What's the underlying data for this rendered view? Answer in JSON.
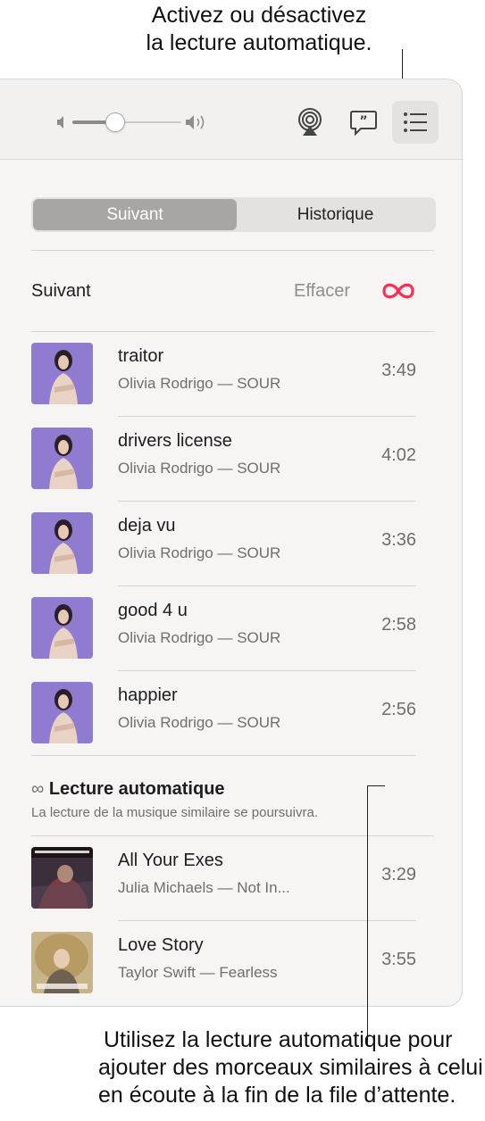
{
  "callouts": {
    "top_line1": "Activez ou désactivez",
    "top_line2": "la lecture automatique.",
    "bottom_line1": "Utilisez la lecture automatique pour",
    "bottom_line2": "ajouter des morceaux similaires à celui",
    "bottom_line3": "en écoute à la fin de la file d’attente."
  },
  "toolbar": {
    "volume_level": 0.38,
    "icons": [
      "volume-low-icon",
      "volume-high-icon",
      "airplay-icon",
      "lyrics-icon",
      "queue-list-icon"
    ]
  },
  "tabs": {
    "next": "Suivant",
    "history": "Historique",
    "selected": "Suivant"
  },
  "queue": {
    "section_title": "Suivant",
    "clear_label": "Effacer",
    "autoplay_icon": "infinity-icon",
    "accent_color": "#ff2d55",
    "tracks": [
      {
        "title": "traitor",
        "subtitle": "Olivia Rodrigo — SOUR",
        "duration": "3:49"
      },
      {
        "title": "drivers license",
        "subtitle": "Olivia Rodrigo — SOUR",
        "duration": "4:02"
      },
      {
        "title": "deja vu",
        "subtitle": "Olivia Rodrigo — SOUR",
        "duration": "3:36"
      },
      {
        "title": "good 4 u",
        "subtitle": "Olivia Rodrigo — SOUR",
        "duration": "2:58"
      },
      {
        "title": "happier",
        "subtitle": "Olivia Rodrigo — SOUR",
        "duration": "2:56"
      }
    ]
  },
  "autoplay": {
    "symbol": "∞",
    "heading": "Lecture automatique",
    "description": "La lecture de la musique similaire se poursuivra.",
    "tracks": [
      {
        "title": "All Your Exes",
        "subtitle": "Julia Michaels — Not In...",
        "duration": "3:29"
      },
      {
        "title": "Love Story",
        "subtitle": "Taylor Swift — Fearless",
        "duration": "3:55"
      }
    ]
  }
}
